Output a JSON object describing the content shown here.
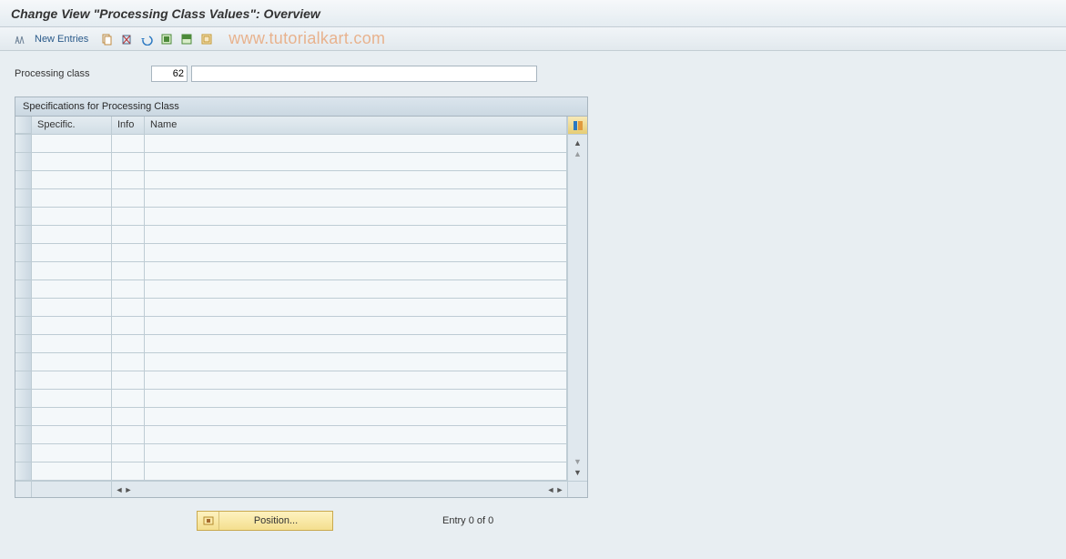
{
  "title": "Change View \"Processing Class Values\": Overview",
  "toolbar": {
    "new_entries_label": "New Entries",
    "watermark": "www.tutorialkart.com"
  },
  "field": {
    "label": "Processing class",
    "value": "62",
    "desc_value": ""
  },
  "table": {
    "title": "Specifications for Processing Class",
    "columns": {
      "specific": "Specific.",
      "info": "Info",
      "name": "Name"
    },
    "row_count": 19
  },
  "footer": {
    "position_label": "Position...",
    "entry_text": "Entry 0 of 0"
  }
}
